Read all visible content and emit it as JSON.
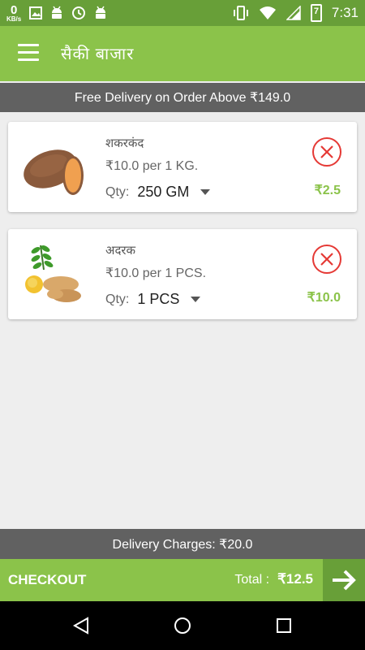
{
  "status_bar": {
    "net_speed_value": "0",
    "net_speed_unit": "KB/s",
    "time": "7:31",
    "battery_level": "7"
  },
  "app_bar": {
    "title": "सैकी बाजार",
    "menu_icon": "hamburger-menu-icon"
  },
  "banner": {
    "text": "Free Delivery on Order Above ₹149.0"
  },
  "cart": {
    "items": [
      {
        "name": "शकरकंद",
        "price": "₹10.0 per 1 KG.",
        "qty_label": "Qty:",
        "qty_value": "250 GM",
        "line_total": "₹2.5",
        "image": "sweet-potato-image"
      },
      {
        "name": "अदरक",
        "price": "₹10.0 per 1 PCS.",
        "qty_label": "Qty:",
        "qty_value": "1 PCS",
        "line_total": "₹10.0",
        "image": "ginger-lemon-image"
      }
    ]
  },
  "delivery": {
    "text": "Delivery Charges: ₹20.0"
  },
  "checkout": {
    "label": "CHECKOUT",
    "total_label": "Total :",
    "total_value": "₹12.5"
  },
  "colors": {
    "primary": "#8bc34a",
    "primary_dark": "#689f38",
    "grey_bar": "#616161",
    "remove_red": "#e53935"
  }
}
